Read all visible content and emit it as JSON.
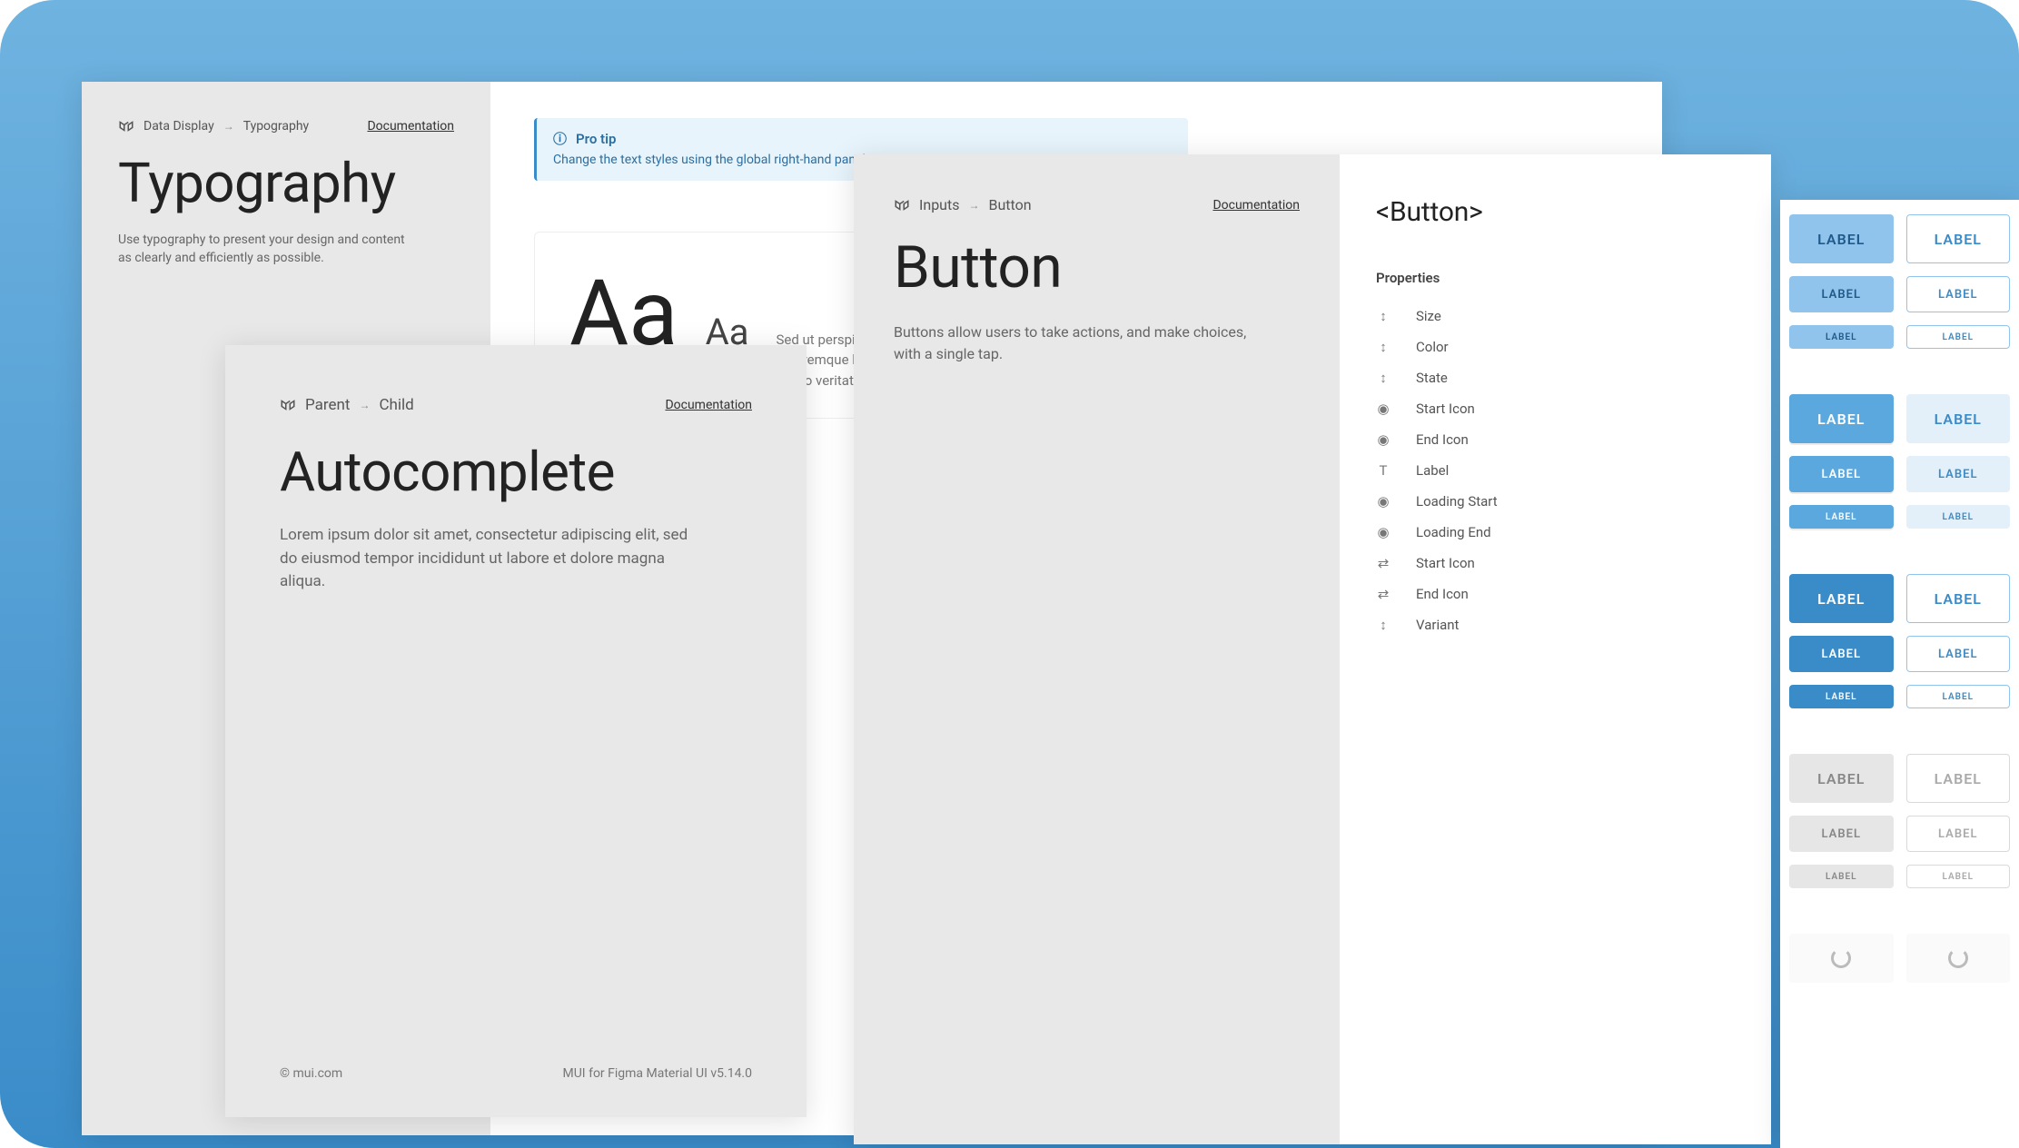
{
  "panels": {
    "typography": {
      "crumb_parent": "Data Display",
      "crumb_child": "Typography",
      "doc_link": "Documentation",
      "title": "Typography",
      "desc": "Use typography to present your design and content as clearly and efficiently as possible.",
      "protip_title": "Pro tip",
      "protip_body": "Change the text styles using the global right-hand panel. Re",
      "sample_big": "Aa",
      "sample_small": "Aa",
      "sample_text": "Sed ut perspiciatis unde omnis iste natus error sit voluptatem doloremque laudantium, totam rem aperiam, eaque ipsa quae ab illo veritatis et quasi architecto"
    },
    "autocomplete": {
      "crumb_parent": "Parent",
      "crumb_child": "Child",
      "doc_link": "Documentation",
      "title": "Autocomplete",
      "desc": "Lorem ipsum dolor sit amet, consectetur adipiscing elit, sed do eiusmod tempor incididunt ut labore et dolore magna aliqua.",
      "footer_left": "© mui.com",
      "footer_right": "MUI for Figma Material UI v5.14.0"
    },
    "button": {
      "crumb_parent": "Inputs",
      "crumb_child": "Button",
      "doc_link": "Documentation",
      "title": "Button",
      "desc": "Buttons allow users to take actions, and make choices, with a single tap.",
      "component_tag": "<Button>",
      "props_heading": "Properties",
      "props": [
        {
          "icon": "↕",
          "label": "Size"
        },
        {
          "icon": "↕",
          "label": "Color"
        },
        {
          "icon": "↕",
          "label": "State"
        },
        {
          "icon": "◉",
          "label": "Start Icon"
        },
        {
          "icon": "◉",
          "label": "End Icon"
        },
        {
          "icon": "T",
          "label": "Label"
        },
        {
          "icon": "◉",
          "label": "Loading Start"
        },
        {
          "icon": "◉",
          "label": "Loading End"
        },
        {
          "icon": "⇄",
          "label": "Start Icon"
        },
        {
          "icon": "⇄",
          "label": "End Icon"
        },
        {
          "icon": "↕",
          "label": "Variant"
        }
      ]
    }
  },
  "button_label": "LABEL"
}
